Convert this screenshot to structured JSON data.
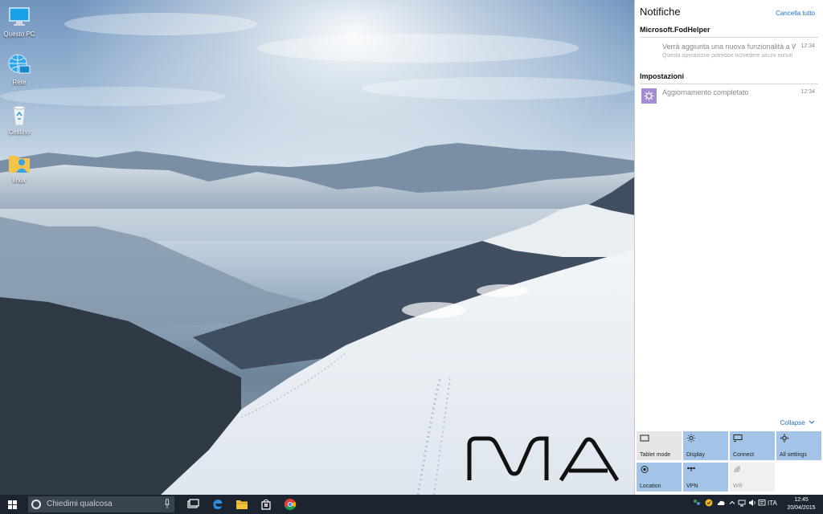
{
  "desktop": {
    "icons": [
      {
        "label": "Questo PC",
        "icon": "this-pc-icon"
      },
      {
        "label": "Rete",
        "icon": "network-icon"
      },
      {
        "label": "Cestino",
        "icon": "recycle-bin-icon"
      },
      {
        "label": "linux",
        "icon": "user-folder-icon"
      }
    ],
    "watermark": "MA"
  },
  "action_center": {
    "title": "Notifiche",
    "clear_all": "Cancella tutto",
    "groups": [
      {
        "name": "Microsoft.FodHelper",
        "notifications": [
          {
            "title": "Verrà aggiunta una nuova funzionalità a Windows",
            "body": "Questa operazione potrebbe richiedere alcuni minuti",
            "time": "12:34"
          }
        ]
      },
      {
        "name": "Impostazioni",
        "notifications": [
          {
            "title": "Aggiornamento completato",
            "body": "",
            "time": "12:34",
            "icon": "gear-icon"
          }
        ]
      }
    ],
    "collapse_label": "Collapse",
    "quick_actions": [
      {
        "label": "Tablet mode",
        "icon": "tablet-mode-icon",
        "state": "off"
      },
      {
        "label": "Display",
        "icon": "brightness-icon",
        "state": "on"
      },
      {
        "label": "Connect",
        "icon": "connect-icon",
        "state": "on"
      },
      {
        "label": "All settings",
        "icon": "gear-icon",
        "state": "on"
      },
      {
        "label": "Location",
        "icon": "location-icon",
        "state": "on"
      },
      {
        "label": "VPN",
        "icon": "vpn-icon",
        "state": "on"
      },
      {
        "label": "Wifi",
        "icon": "wifi-icon",
        "state": "disabled"
      }
    ]
  },
  "taskbar": {
    "search_placeholder": "Chiedimi qualcosa",
    "apps": [
      "task-view-icon",
      "edge-icon",
      "file-explorer-icon",
      "store-icon",
      "chrome-icon"
    ],
    "language": "ITA",
    "time": "12:45",
    "date": "20/04/2015"
  },
  "colors": {
    "accent": "#1f6fc5",
    "tile_on": "#a3c4e6",
    "tile_off": "#e6e6e6",
    "taskbar": "#1c2430"
  }
}
